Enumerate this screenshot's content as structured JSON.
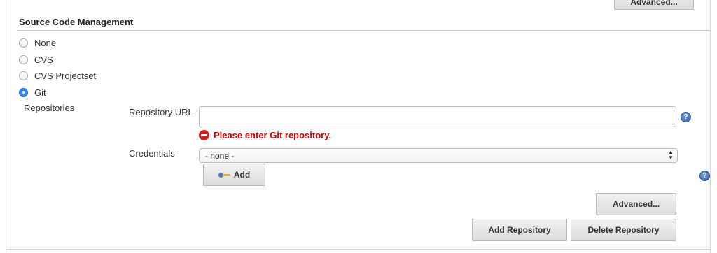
{
  "top": {
    "advanced_label": "Advanced..."
  },
  "section": {
    "title": "Source Code Management"
  },
  "scm_options": [
    {
      "label": "None",
      "checked": false
    },
    {
      "label": "CVS",
      "checked": false
    },
    {
      "label": "CVS Projectset",
      "checked": false
    },
    {
      "label": "Git",
      "checked": true
    }
  ],
  "repositories": {
    "label": "Repositories",
    "repository_url": {
      "label": "Repository URL",
      "value": "",
      "error": "Please enter Git repository."
    },
    "credentials": {
      "label": "Credentials",
      "selected": "- none -",
      "add_label": "Add"
    },
    "advanced_label": "Advanced...",
    "add_repository_label": "Add Repository",
    "delete_repository_label": "Delete Repository"
  },
  "help_icon_glyph": "?",
  "colors": {
    "error": "#cc0000",
    "radio_selected": "#2f8cf0",
    "help_icon": "#2d5fa5"
  }
}
